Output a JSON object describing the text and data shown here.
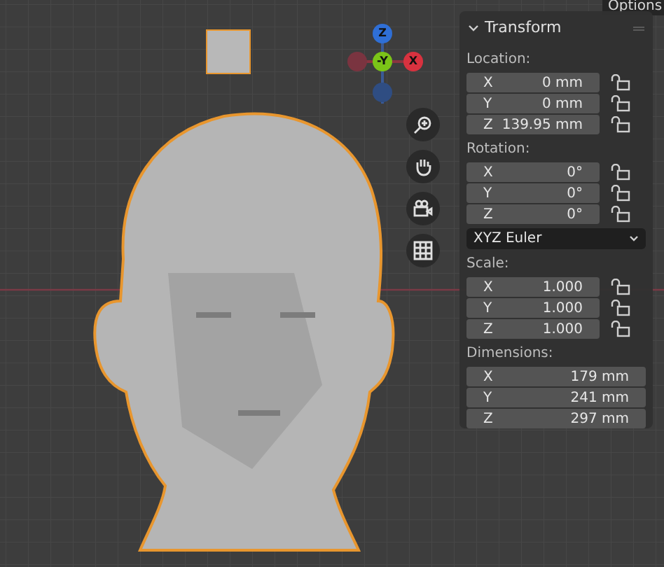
{
  "gizmo": {
    "axes": [
      {
        "label": "Z",
        "kind": "top",
        "color": "#2f6fd6"
      },
      {
        "label": "-Y",
        "kind": "center",
        "color": "#7bc418"
      },
      {
        "label": "X",
        "kind": "right",
        "color": "#d8323f"
      }
    ]
  },
  "panel": {
    "tab": "Options",
    "title": "Transform",
    "expanded": true,
    "sections": [
      {
        "kind": "fields",
        "label": "Location:",
        "fields": [
          {
            "axis": "X",
            "value": "0 mm",
            "locked": false
          },
          {
            "axis": "Y",
            "value": "0 mm",
            "locked": false
          },
          {
            "axis": "Z",
            "value": "139.95 mm",
            "locked": false
          }
        ]
      },
      {
        "kind": "fields",
        "label": "Rotation:",
        "fields": [
          {
            "axis": "X",
            "value": "0°",
            "locked": false
          },
          {
            "axis": "Y",
            "value": "0°",
            "locked": false
          },
          {
            "axis": "Z",
            "value": "0°",
            "locked": false
          }
        ]
      },
      {
        "kind": "dropdown",
        "value": "XYZ Euler"
      },
      {
        "kind": "fields",
        "label": "Scale:",
        "fields": [
          {
            "axis": "X",
            "value": "1.000",
            "locked": false
          },
          {
            "axis": "Y",
            "value": "1.000",
            "locked": false
          },
          {
            "axis": "Z",
            "value": "1.000",
            "locked": false
          }
        ]
      },
      {
        "kind": "fields",
        "label": "Dimensions:",
        "fields": [
          {
            "axis": "X",
            "value": "179 mm"
          },
          {
            "axis": "Y",
            "value": "241 mm"
          },
          {
            "axis": "Z",
            "value": "297 mm"
          }
        ]
      }
    ]
  }
}
